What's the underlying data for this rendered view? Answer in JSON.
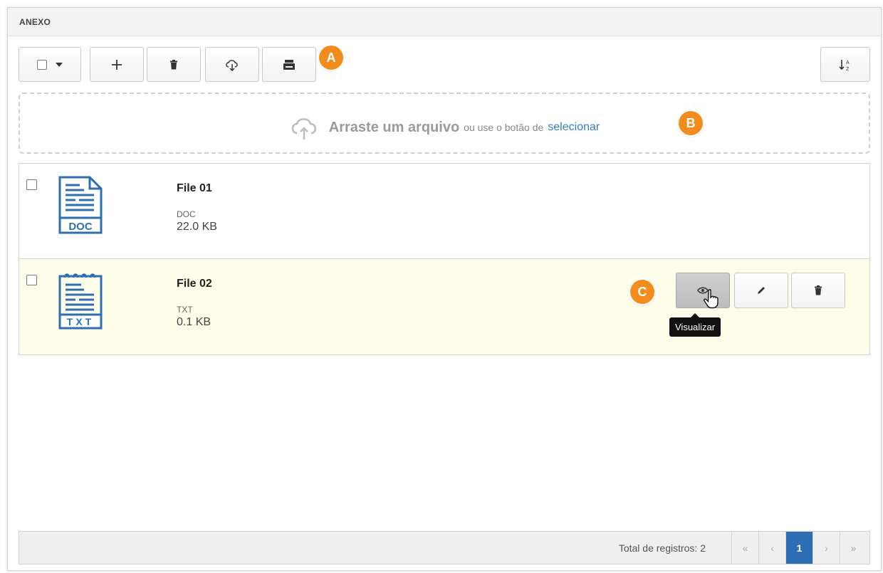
{
  "panel": {
    "title": "ANEXO"
  },
  "toolbar": {
    "add_icon": "plus-icon",
    "delete_icon": "trash-icon",
    "download_icon": "cloud-download-icon",
    "scanner_icon": "scanner-icon",
    "sort_icon": "sort-alpha-icon"
  },
  "markers": {
    "a": "A",
    "b": "B",
    "c": "C"
  },
  "dropzone": {
    "strong_text": "Arraste um arquivo",
    "middle_text": "ou use o botão de",
    "link_text": "selecionar"
  },
  "files": [
    {
      "name": "File 01",
      "type": "DOC",
      "size": "22.0 KB",
      "icon_label": "DOC"
    },
    {
      "name": "File 02",
      "type": "TXT",
      "size": "0.1 KB",
      "icon_label": "TXT"
    }
  ],
  "row_actions": {
    "tooltip": "Visualizar"
  },
  "footer": {
    "total_label": "Total de registros: 2",
    "first": "«",
    "prev": "‹",
    "current_page": "1",
    "next": "›",
    "last": "»"
  },
  "colors": {
    "accent": "#2e6fb4",
    "marker": "#f28c1c",
    "icon": "#2f6fb0",
    "selected_row": "#fdfdea"
  }
}
